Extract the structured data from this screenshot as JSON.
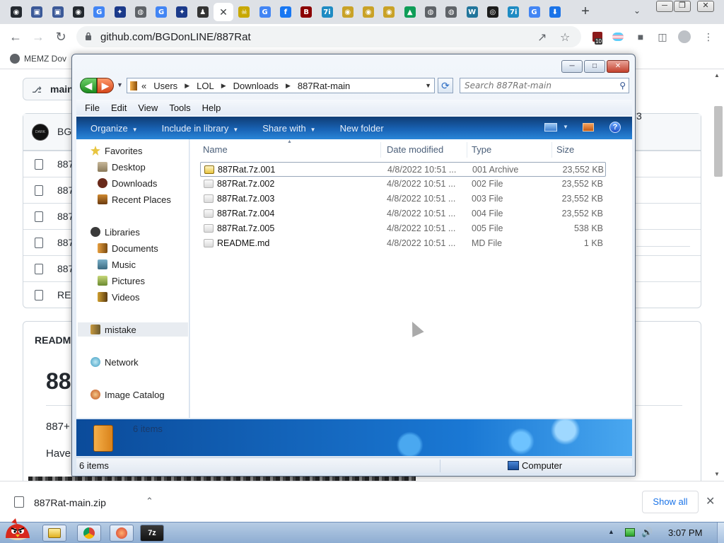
{
  "browser": {
    "tabs": [
      {
        "icon": "github-icon",
        "color": "#24292f",
        "glyph": "◉"
      },
      {
        "icon": "blue-square-icon",
        "color": "#3b5998",
        "glyph": "▣"
      },
      {
        "icon": "blue-square-icon",
        "color": "#3b5998",
        "glyph": "▣"
      },
      {
        "icon": "github-icon",
        "color": "#24292f",
        "glyph": "◉"
      },
      {
        "icon": "google-icon",
        "color": "#4285f4",
        "glyph": "G"
      },
      {
        "icon": "app-icon",
        "color": "#1b3a8a",
        "glyph": "✦"
      },
      {
        "icon": "globe-icon",
        "color": "#5f6368",
        "glyph": "◍"
      },
      {
        "icon": "google-icon",
        "color": "#4285f4",
        "glyph": "G"
      },
      {
        "icon": "app-icon",
        "color": "#1b3a8a",
        "glyph": "✦"
      },
      {
        "icon": "ghost-icon",
        "color": "#333333",
        "glyph": "♟"
      },
      {
        "icon": "close-icon",
        "color": "#ffffff",
        "glyph": "✕",
        "active": true
      },
      {
        "icon": "skull-icon",
        "color": "#c8a800",
        "glyph": "☠"
      },
      {
        "icon": "google-icon",
        "color": "#4285f4",
        "glyph": "G"
      },
      {
        "icon": "facebook-icon",
        "color": "#1877f2",
        "glyph": "f"
      },
      {
        "icon": "b-icon",
        "color": "#8b0000",
        "glyph": "B"
      },
      {
        "icon": "7z-icon",
        "color": "#1e8bc3",
        "glyph": "7i"
      },
      {
        "icon": "seal-icon",
        "color": "#c9a227",
        "glyph": "◉"
      },
      {
        "icon": "seal-icon",
        "color": "#c9a227",
        "glyph": "◉"
      },
      {
        "icon": "seal-icon",
        "color": "#c9a227",
        "glyph": "◉"
      },
      {
        "icon": "drive-icon",
        "color": "#0f9d58",
        "glyph": "▲"
      },
      {
        "icon": "globe-icon",
        "color": "#5f6368",
        "glyph": "◍"
      },
      {
        "icon": "globe-icon",
        "color": "#5f6368",
        "glyph": "◍"
      },
      {
        "icon": "wordpress-icon",
        "color": "#21759b",
        "glyph": "W"
      },
      {
        "icon": "dark-app-icon",
        "color": "#1c1c1c",
        "glyph": "◎"
      },
      {
        "icon": "7z-icon",
        "color": "#1e8bc3",
        "glyph": "7i"
      },
      {
        "icon": "google-icon",
        "color": "#4285f4",
        "glyph": "G"
      },
      {
        "icon": "download-icon",
        "color": "#1a73e8",
        "glyph": "⬇"
      }
    ],
    "new_tab": "+",
    "url": "github.com/BGDonLINE/887Rat",
    "extension_badge": "10",
    "bookmark": "MEMZ Dov"
  },
  "github": {
    "branch": "main",
    "commit_author": "BG",
    "commit_count": "3",
    "files": [
      "887",
      "887",
      "887",
      "887",
      "887",
      "REA"
    ],
    "readme_label": "READM",
    "readme_title": "88",
    "readme_p1": "887+",
    "readme_p2": "Have"
  },
  "explorer": {
    "breadcrumb": [
      "Users",
      "LOL",
      "Downloads",
      "887Rat-main"
    ],
    "breadcrumb_prefix": "«",
    "search_placeholder": "Search 887Rat-main",
    "menu": [
      "File",
      "Edit",
      "View",
      "Tools",
      "Help"
    ],
    "commands": [
      "Organize",
      "Include in library",
      "Share with",
      "New folder"
    ],
    "nav": {
      "favorites": "Favorites",
      "desktop": "Desktop",
      "downloads": "Downloads",
      "recent": "Recent Places",
      "libraries": "Libraries",
      "documents": "Documents",
      "music": "Music",
      "pictures": "Pictures",
      "videos": "Videos",
      "mistake": "mistake",
      "network": "Network",
      "catalog": "Image Catalog"
    },
    "columns": {
      "name": "Name",
      "date": "Date modified",
      "type": "Type",
      "size": "Size"
    },
    "files": [
      {
        "name": "887Rat.7z.001",
        "date": "4/8/2022 10:51 ...",
        "type": "001 Archive",
        "size": "23,552 KB"
      },
      {
        "name": "887Rat.7z.002",
        "date": "4/8/2022 10:51 ...",
        "type": "002 File",
        "size": "23,552 KB"
      },
      {
        "name": "887Rat.7z.003",
        "date": "4/8/2022 10:51 ...",
        "type": "003 File",
        "size": "23,552 KB"
      },
      {
        "name": "887Rat.7z.004",
        "date": "4/8/2022 10:51 ...",
        "type": "004 File",
        "size": "23,552 KB"
      },
      {
        "name": "887Rat.7z.005",
        "date": "4/8/2022 10:51 ...",
        "type": "005 File",
        "size": "538 KB"
      },
      {
        "name": "README.md",
        "date": "4/8/2022 10:51 ...",
        "type": "MD File",
        "size": "1 KB"
      }
    ],
    "details_count": "6 items",
    "status_count": "6 items",
    "status_location": "Computer"
  },
  "downloads": {
    "file": "887Rat-main.zip",
    "show_all": "Show all"
  },
  "taskbar": {
    "items": [
      {
        "icon": "folder-icon",
        "color": "#e8b830",
        "glyph": "▭"
      },
      {
        "icon": "chrome-icon",
        "color": "#db4437",
        "glyph": "◉"
      },
      {
        "icon": "red-app-icon",
        "color": "#d43a2a",
        "glyph": "◉"
      },
      {
        "icon": "7zip-icon",
        "color": "#222222",
        "glyph": "7z"
      }
    ],
    "clock": "3:07 PM"
  }
}
